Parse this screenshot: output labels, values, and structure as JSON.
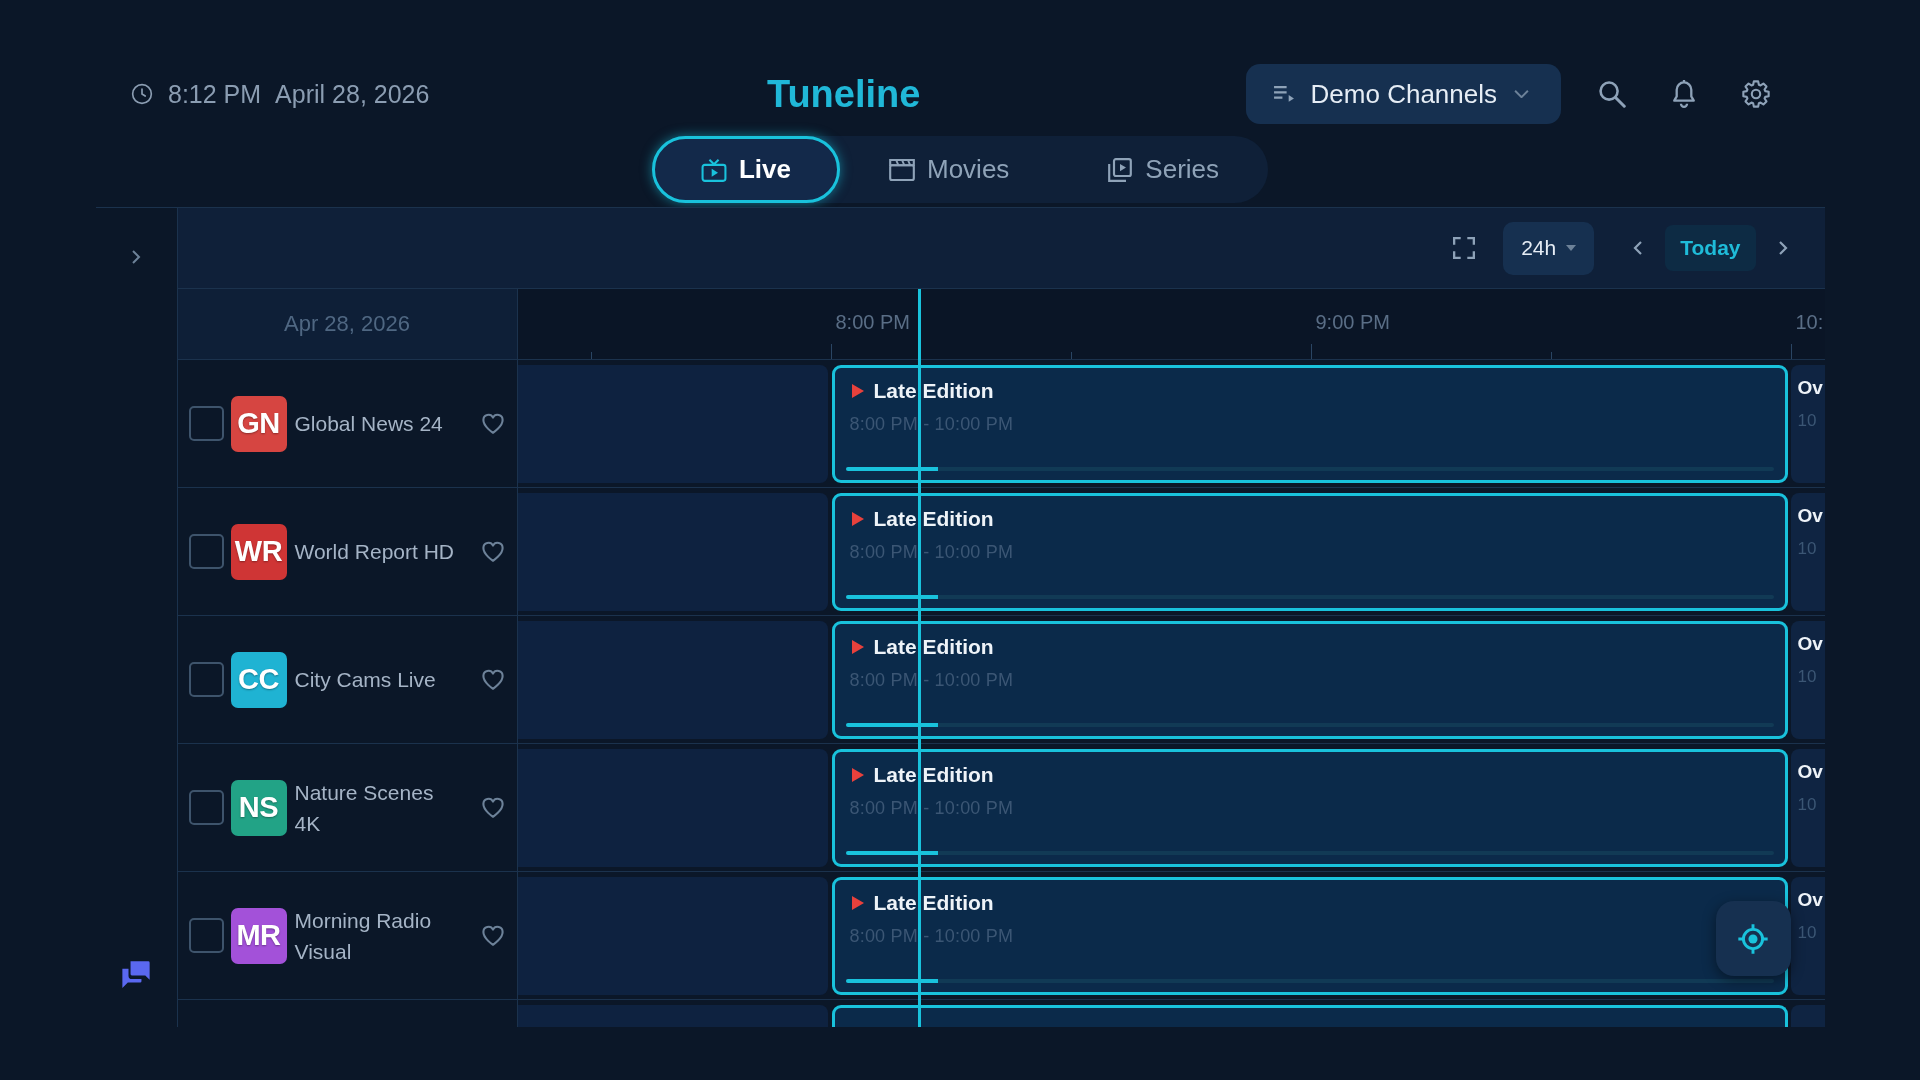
{
  "header": {
    "time": "8:12 PM",
    "date": "April 28, 2026",
    "title": "Tuneline",
    "source": "Demo Channels"
  },
  "tabs": [
    {
      "label": "Live",
      "selected": true
    },
    {
      "label": "Movies",
      "selected": false
    },
    {
      "label": "Series",
      "selected": false
    }
  ],
  "toolbar": {
    "range": "24h",
    "today": "Today"
  },
  "guide": {
    "date": "Apr 28, 2026",
    "times": [
      "8:00 PM",
      "9:00 PM",
      "10:"
    ],
    "more_below": true,
    "channels": [
      {
        "logo": "GN",
        "color": "#d64541",
        "name": "Global News 24",
        "checked": false,
        "favorite": false,
        "program": {
          "title": "Late Edition",
          "time": "8:00 PM - 10:00 PM",
          "live": true,
          "level": 0.1
        },
        "next": {
          "title": "Ov",
          "time": "10"
        }
      },
      {
        "logo": "WR",
        "color": "#cf3535",
        "name": "World Report HD",
        "checked": false,
        "favorite": false,
        "program": {
          "title": "Late Edition",
          "time": "8:00 PM - 10:00 PM",
          "live": true,
          "level": 0.1
        },
        "next": {
          "title": "Ov",
          "time": "10"
        }
      },
      {
        "logo": "CC",
        "color": "#1fb3d3",
        "name": "City Cams Live",
        "checked": false,
        "favorite": false,
        "program": {
          "title": "Late Edition",
          "time": "8:00 PM - 10:00 PM",
          "live": true,
          "level": 0.1
        },
        "next": {
          "title": "Ov",
          "time": "10"
        }
      },
      {
        "logo": "NS",
        "color": "#22a386",
        "name": "Nature Scenes 4K",
        "checked": false,
        "favorite": false,
        "program": {
          "title": "Late Edition",
          "time": "8:00 PM - 10:00 PM",
          "live": true,
          "level": 0.1
        },
        "next": {
          "title": "Ov",
          "time": "10"
        }
      },
      {
        "logo": "MR",
        "color": "#a351d9",
        "name": "Morning Radio Visual",
        "checked": false,
        "favorite": false,
        "program": {
          "title": "Late Edition",
          "time": "8:00 PM - 10:00 PM",
          "live": true,
          "level": 0.1
        },
        "next": {
          "title": "Ov",
          "time": "10"
        }
      }
    ]
  }
}
